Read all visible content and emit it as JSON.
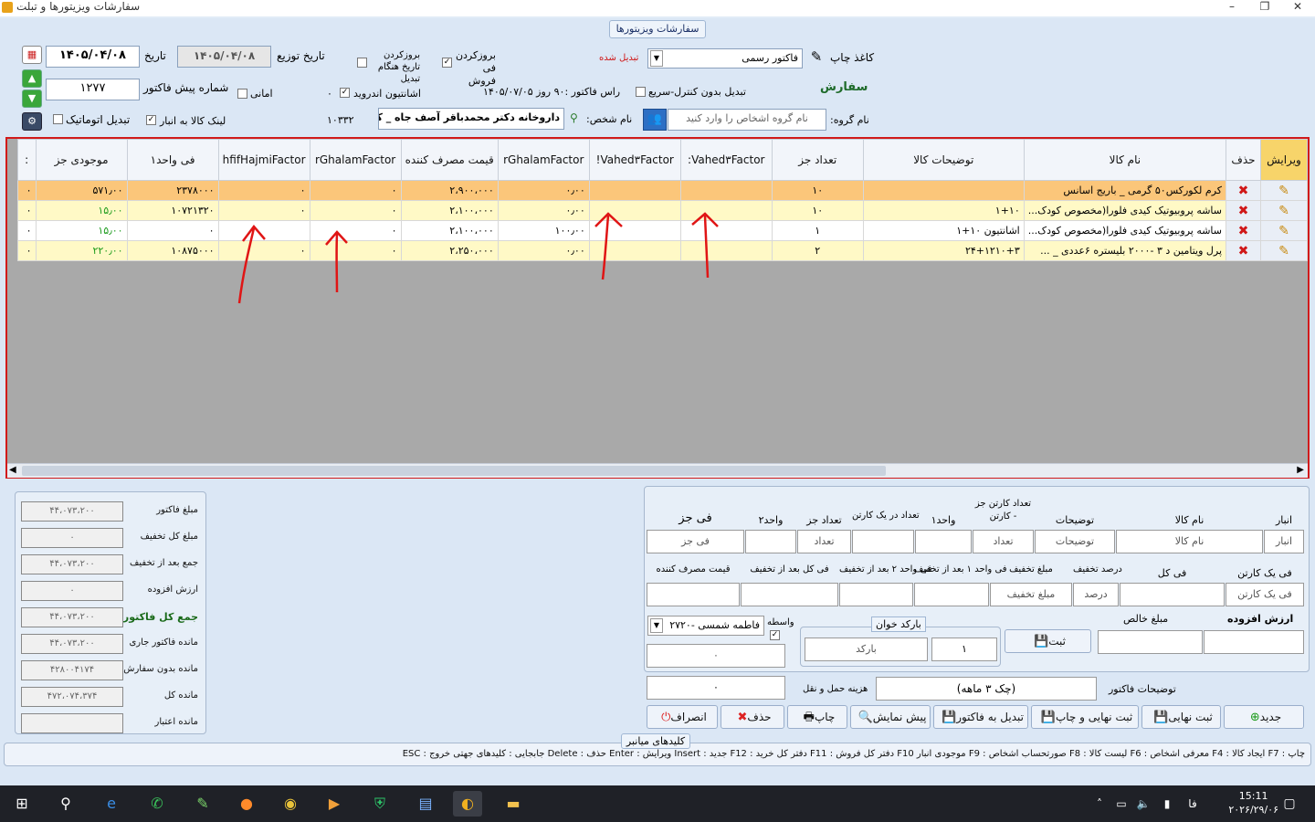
{
  "window": {
    "title": "سفارشات ویزیتورها و تبلت",
    "minimize": "–",
    "maximize": "❐",
    "close": "✕"
  },
  "group_title": "سفارشات ویزیتورها",
  "header": {
    "date_label": "تاریخ",
    "date_value": "۱۴۰۵/۰۴/۰۸",
    "dist_date_label": "تاریخ توزیع",
    "dist_date_value": "۱۴۰۵/۰۴/۰۸",
    "invoice_no_label": "شماره پیش فاکتور",
    "invoice_no_value": "۱۲۷۷",
    "update_date_label": "بروزکردن تاریخ هنگام تبدیل",
    "update_price_label": "بروزکردن فی فروش",
    "print_paper_label": "کاغذ چاپ",
    "print_paper_value": "فاکتور رسمی",
    "converted_label": "تبدیل شده",
    "convert_no_control_label": "تبدیل بدون کنترل-سریع",
    "due_label": "راس فاکتور :۹۰ روز ۱۴۰۵/۰۷/۰۵",
    "order_label": "سفارش",
    "amani_label": "امانی",
    "android_label": "اشانتیون اندروید",
    "android_value": "۰",
    "auto_convert_label": "تبدیل اتوماتیک",
    "link_stock_label": "لینک کالا به انبار",
    "person_code": "۱۰۳۳۲",
    "person_label": "نام شخص:",
    "person_value": "داروخانه دکتر محمدباقر آصف جاه _ کازرو",
    "group_label": "نام گروه:",
    "group_placeholder": "نام گروه اشخاص را وارد کنید"
  },
  "grid": {
    "columns": [
      "ویرایش",
      "حذف",
      "نام کالا",
      "توضیحات کالا",
      "تعداد جز",
      "Vahed۳Factor:",
      "Vahed۳Factor!",
      "rGhalamFactor",
      "قیمت مصرف کننده",
      "rGhalamFactor",
      "hfifHajmiFactor",
      "فی واحد۱",
      "موجودی جز",
      ":"
    ],
    "rows": [
      {
        "name": "کرم لکورکس۵۰ گرمی _ باریج اسانس",
        "desc": "",
        "qty": "۱۰",
        "v3a": "",
        "v3b": "",
        "rg1": "۰٫۰۰",
        "consumer": "۲،۹۰۰،۰۰۰",
        "rg2": "۰",
        "hfif": "۰",
        "unit_price": "۲۳۷۸۰۰۰",
        "stock": "۵۷۱٫۰۰",
        "last": "۰"
      },
      {
        "name": "ساشه پروبیوتیک کیدی فلورا(مخصوص کودک...",
        "desc": "۱+۱۰",
        "qty": "۱۰",
        "v3a": "",
        "v3b": "",
        "rg1": "۰٫۰۰",
        "consumer": "۲،۱۰۰،۰۰۰",
        "rg2": "۰",
        "hfif": "۰",
        "unit_price": "۱۰۷۲۱۳۲۰",
        "stock": "۱۵٫۰۰",
        "last": "۰"
      },
      {
        "name": "ساشه پروبیوتیک کیدی فلورا(مخصوص کودک...",
        "desc": "اشانتیون ۱۰+۱",
        "qty": "۱",
        "v3a": "",
        "v3b": "",
        "rg1": "۱۰۰٫۰۰",
        "consumer": "۲،۱۰۰،۰۰۰",
        "rg2": "۰",
        "hfif": "",
        "unit_price": "۰",
        "stock": "۱۵٫۰۰",
        "last": "۰"
      },
      {
        "name": "پرل ویتامین د ۳ -۲۰۰۰ بلیستره ۶عددی _ ...",
        "desc": "۲۴+۱۲۱۰+۳",
        "qty": "۲",
        "v3a": "",
        "v3b": "",
        "rg1": "۰٫۰۰",
        "consumer": "۲،۲۵۰،۰۰۰",
        "rg2": "۰",
        "hfif": "۰",
        "unit_price": "۱۰۸۷۵۰۰۰",
        "stock": "۲۲۰٫۰۰",
        "last": "۰"
      }
    ]
  },
  "summary": [
    {
      "label": "مبلغ فاکتور",
      "value": "۴۴،۰۷۳،۲۰۰"
    },
    {
      "label": "مبلغ کل تخفیف",
      "value": "۰"
    },
    {
      "label": "جمع بعد از تخفیف",
      "value": "۴۴،۰۷۳،۲۰۰"
    },
    {
      "label": "ارزش افزوده",
      "value": "۰"
    },
    {
      "label": "جمع کل فاکتور",
      "value": "۴۴،۰۷۳،۲۰۰"
    },
    {
      "label": "مانده فاکتور جاری",
      "value": "۴۴،۰۷۳،۲۰۰"
    },
    {
      "label": "مانده بدون سفارش جاری",
      "value": "۴۲۸۰۰۴۱۷۴"
    },
    {
      "label": "مانده کل",
      "value": "۴۷۲،۰۷۴،۳۷۴"
    },
    {
      "label": "مانده اعتبار",
      "value": ""
    }
  ],
  "entry": {
    "h1": [
      "انبار",
      "نام کالا",
      "توضیحات",
      "تعداد کارتن جز - کارتن",
      "واحد۱",
      "تعداد در یک کارتن",
      "تعداد جز",
      "واحد۲",
      "فی جز"
    ],
    "r1": [
      "انبار",
      "نام کالا",
      "توضیحات",
      "تعداد",
      "",
      "",
      "تعداد",
      "",
      "فی جز"
    ],
    "h2": [
      "فی یک کارتن",
      "فی کل",
      "درصد تخفیف",
      "مبلغ تخفیف",
      "فی واحد ۱ بعد از تخفیف",
      "فی واحد ۲ بعد از تخفیف",
      "فی کل بعد از تخفیف",
      "قیمت مصرف کننده"
    ],
    "r2": [
      "فی یک کارتن",
      "",
      "درصد",
      "مبلغ تخفیف",
      "",
      "",
      "",
      ""
    ],
    "vat_label": "ارزش افزوده",
    "net_label": "مبلغ خالص",
    "save_label": "ثبت",
    "barcode_title": "بارکد خوان",
    "barcode_placeholder": "بارکد",
    "barcode_qty": "۱",
    "broker_label": "واسطه",
    "broker_value": "فاطمه شمسی -۲۷۲۰",
    "broker_extra": "۰",
    "notes_label": "توضیحات فاکتور",
    "notes_value": "(چک ۳ ماهه)",
    "shipping_label": "هزینه حمل و نقل",
    "shipping_value": "۰"
  },
  "buttons": {
    "new": "جدید",
    "final": "ثبت نهایی",
    "final_print": "ثبت نهایی و چاپ",
    "convert": "تبدیل به فاکتور",
    "preview": "پیش نمایش",
    "print": "چاپ",
    "delete": "حذف",
    "cancel": "انصراف"
  },
  "shortcuts_title": "کلیدهای میانبر",
  "shortcuts": "چاپ : F7 ایجاد کالا : F4 معرفی اشخاص : F6 لیست کالا : F8 صورتحساب اشخاص : F9 موجودی انبار F10 دفتر کل فروش : F11 دفتر کل خرید : F12 جدید : Insert ویرایش : Enter حذف : Delete جابجایی : کلیدهای جهتی خروج : ESC",
  "taskbar": {
    "time": "15:11",
    "date": "۲۰۲۶/۲۹/۰۶",
    "lang": "فا"
  }
}
